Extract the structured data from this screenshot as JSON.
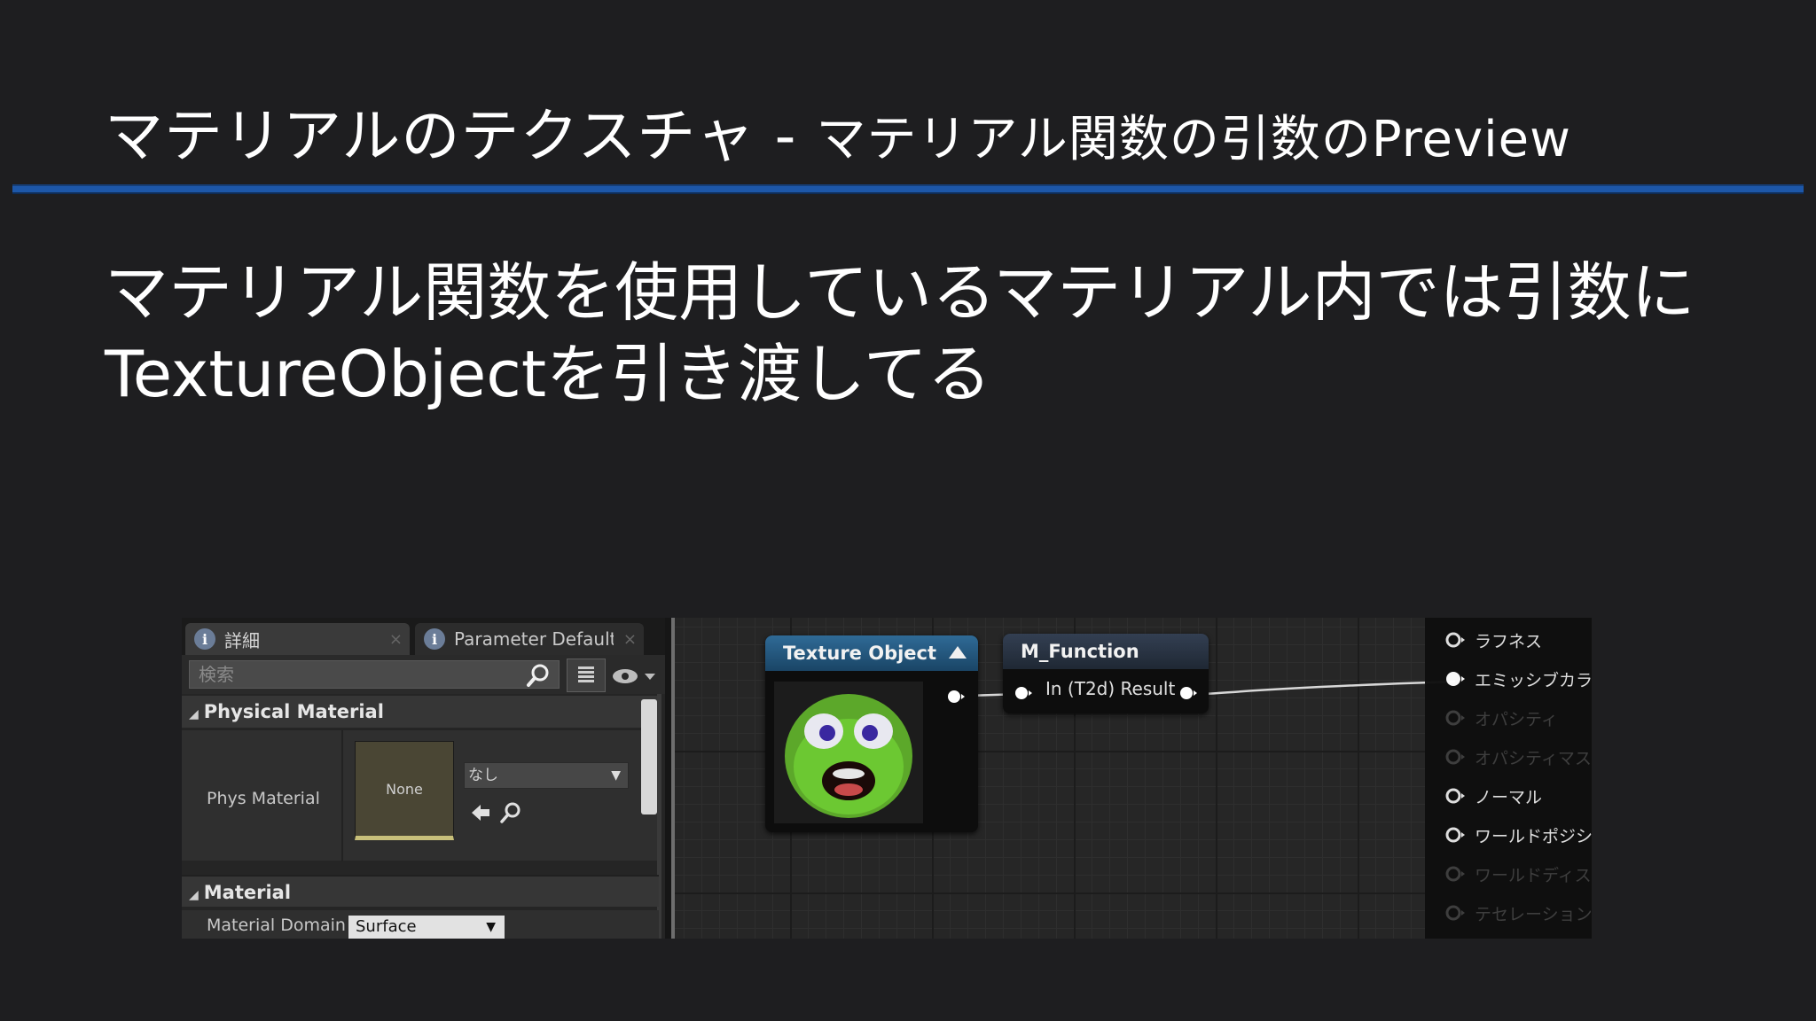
{
  "slide": {
    "title_main": "マテリアルのテクスチャ - ",
    "title_sub": "マテリアル関数の引数のPreview",
    "body_line1": "マテリアル関数を使用しているマテリアル内では引数に",
    "body_line2": "TextureObjectを引き渡してる",
    "rule_color": "#1d57a8"
  },
  "details_panel": {
    "tabs": [
      {
        "label": "詳細",
        "icon": "info-icon"
      },
      {
        "label": "Parameter Defaults",
        "icon": "info-icon"
      }
    ],
    "search_placeholder": "検索",
    "categories": [
      {
        "label": "Physical Material",
        "properties": [
          {
            "label": "Phys Material",
            "thumbnail_text": "None",
            "value": "なし"
          }
        ]
      },
      {
        "label": "Material",
        "properties": [
          {
            "label": "Material Domain",
            "value": "Surface"
          }
        ]
      }
    ]
  },
  "graph": {
    "texture_node": {
      "title": "Texture Object",
      "header_color": "#2f6a96"
    },
    "function_node": {
      "title": "M_Function",
      "pins_text": "In (T2d)  Result",
      "header_color": "#333f52"
    },
    "material_pins": [
      {
        "label": "ラフネス",
        "active": true
      },
      {
        "label": "エミッシブカラー",
        "active": true
      },
      {
        "label": "オパシティ",
        "active": false
      },
      {
        "label": "オパシティマスク",
        "active": false
      },
      {
        "label": "ノーマル",
        "active": true
      },
      {
        "label": "ワールドポジションオフセット",
        "active": true
      },
      {
        "label": "ワールドディスプレイスメント",
        "active": false
      },
      {
        "label": "テセレーション乗数",
        "active": false
      }
    ]
  }
}
